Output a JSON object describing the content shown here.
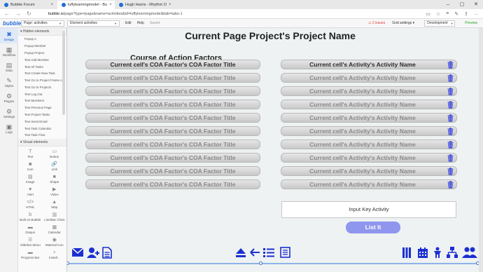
{
  "browser": {
    "tabs": [
      {
        "label": "Bubble Forum",
        "active": false
      },
      {
        "label": "luffylearningmodel - Bu",
        "active": true
      },
      {
        "label": "Hugh Harris - Rhythm O",
        "active": false
      }
    ],
    "url_domain": "bubble.is",
    "url_path": "/page?type=page&name=activities&id=luffylearningmodel&tab=tabs-1"
  },
  "editor": {
    "logo": "bubble",
    "page_selector": "Page: activities",
    "element_selector": "Element activities",
    "menu": [
      "Edit",
      "Help",
      "Saved"
    ],
    "issues": "2 issues",
    "grid_settings": "Grid settings",
    "dev_selector": "Development",
    "preview": "Preview"
  },
  "left_nav": [
    {
      "label": "Design",
      "icon": "design-icon",
      "glyph": "✖",
      "active": true
    },
    {
      "label": "Workflow",
      "icon": "workflow-icon",
      "glyph": "▦",
      "active": false
    },
    {
      "label": "Data",
      "icon": "data-icon",
      "glyph": "▤",
      "active": false
    },
    {
      "label": "Styles",
      "icon": "styles-icon",
      "glyph": "✎",
      "active": false
    },
    {
      "label": "Plugins",
      "icon": "plugins-icon",
      "glyph": "⚙",
      "active": false
    },
    {
      "label": "Settings",
      "icon": "settings-icon",
      "glyph": "⚙",
      "active": false
    },
    {
      "label": "Logs",
      "icon": "logs-icon",
      "glyph": "▣",
      "active": false
    }
  ],
  "elements_panel": {
    "hidden_header": "Hidden elements",
    "hidden_items": [
      "Popup A",
      "Popup Member",
      "Popup Project",
      "Text Add Member",
      "Text All Tasks",
      "Text Create New Task",
      "Text Go to Project Frame or",
      "Text Go to Projects",
      "Text Log Out",
      "Text Members",
      "Text Previous Page",
      "Text Project Tasks",
      "Text Send Email",
      "Text Task Calendar",
      "Text Task Flow"
    ],
    "visual_header": "Visual elements",
    "visual_items": [
      {
        "label": "Text",
        "glyph": "T"
      },
      {
        "label": "Button",
        "glyph": "▭"
      },
      {
        "label": "Icon",
        "glyph": "☻"
      },
      {
        "label": "Link",
        "glyph": "🔗"
      },
      {
        "label": "Image",
        "glyph": "▨"
      },
      {
        "label": "Shape",
        "glyph": "■"
      },
      {
        "label": "Alert",
        "glyph": "♥"
      },
      {
        "label": "Video",
        "glyph": "▶"
      },
      {
        "label": "HTML",
        "glyph": "</>"
      },
      {
        "label": "Map",
        "glyph": "▲"
      },
      {
        "label": "Built on Bubble",
        "glyph": "b"
      },
      {
        "label": "Line/Bar Chart",
        "glyph": "▥"
      },
      {
        "label": "Disqus",
        "glyph": "▬"
      },
      {
        "label": "Calendar",
        "glyph": "▦"
      },
      {
        "label": "Slidebar Menu",
        "glyph": "☰"
      },
      {
        "label": "Material Icon",
        "glyph": "◉"
      },
      {
        "label": "Progress Bar",
        "glyph": "▬"
      },
      {
        "label": "Install...",
        "glyph": "+"
      }
    ]
  },
  "canvas": {
    "page_title": "Current Page Project's Project Name",
    "coa_heading": "Course of Action Factors",
    "coa_rows": [
      "Current cell's COA Factor's COA Factor Title",
      "Current cell's COA Factor's COA Factor Title",
      "Current cell's COA Factor's COA Factor Title",
      "Current cell's COA Factor's COA Factor Title",
      "Current cell's COA Factor's COA Factor Title",
      "Current cell's COA Factor's COA Factor Title",
      "Current cell's COA Factor's COA Factor Title",
      "Current cell's COA Factor's COA Factor Title",
      "Current cell's COA Factor's COA Factor Title",
      "Current cell's COA Factor's COA Factor Title"
    ],
    "activity_rows": [
      "Current cell's Activity's Activity Name",
      "Current cell's Activity's Activity Name",
      "Current cell's Activity's Activity Name",
      "Current cell's Activity's Activity Name",
      "Current cell's Activity's Activity Name",
      "Current cell's Activity's Activity Name",
      "Current cell's Activity's Activity Name",
      "Current cell's Activity's Activity Name",
      "Current cell's Activity's Activity Name",
      "Current cell's Activity's Activity Name"
    ],
    "key_input_placeholder": "Input Key Activity",
    "list_button": "List It",
    "accent_color": "#1c2fd1",
    "button_color": "#8f96ee"
  }
}
